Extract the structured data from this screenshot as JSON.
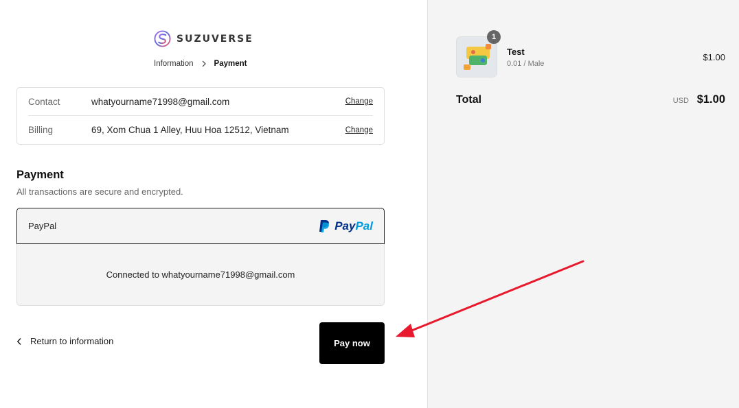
{
  "brand": {
    "name": "SUZUVERSE"
  },
  "breadcrumb": {
    "items": [
      "Information",
      "Payment"
    ]
  },
  "review": {
    "contact_label": "Contact",
    "contact_value": "whatyourname71998@gmail.com",
    "billing_label": "Billing",
    "billing_value": "69, Xom Chua 1 Alley, Huu Hoa 12512, Vietnam",
    "change_label": "Change"
  },
  "payment": {
    "title": "Payment",
    "subtitle": "All transactions are secure and encrypted.",
    "method_label": "PayPal",
    "logo_text_dark": "Pay",
    "logo_text_light": "Pal",
    "connected_text": "Connected to whatyourname71998@gmail.com"
  },
  "actions": {
    "return_label": "Return to information",
    "pay_label": "Pay now"
  },
  "order": {
    "item_name": "Test",
    "item_variant": "0.01 / Male",
    "item_price": "$1.00",
    "quantity": "1",
    "total_label": "Total",
    "currency": "USD",
    "total_value": "$1.00"
  },
  "colors": {
    "annotation_arrow": "#e8192c",
    "paypal_dark": "#003087",
    "paypal_light": "#009cde"
  }
}
